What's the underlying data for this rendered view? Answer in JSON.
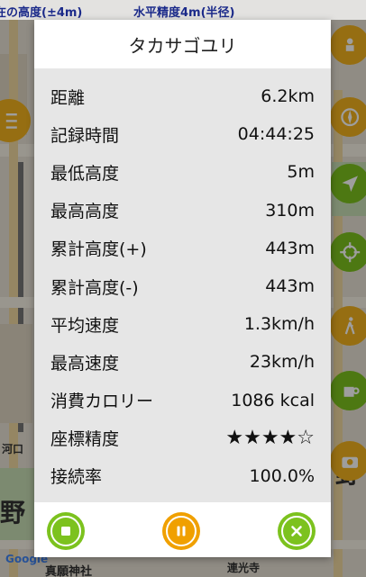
{
  "map": {
    "status_altitude": "在の高度(±4m)",
    "status_accuracy": "水平精度4m(半径)",
    "label_kawaguchi": "河口",
    "label_no": "野",
    "label_no2": "野",
    "label_temple": "真願神社",
    "label_temple2": "連光寺",
    "label_google": "Google"
  },
  "dialog": {
    "title": "タカサゴユリ",
    "rows": [
      {
        "label": "距離",
        "value": "6.2km"
      },
      {
        "label": "記録時間",
        "value": "04:44:25"
      },
      {
        "label": "最低高度",
        "value": "5m"
      },
      {
        "label": "最高高度",
        "value": "310m"
      },
      {
        "label": "累計高度(+)",
        "value": "443m"
      },
      {
        "label": "累計高度(-)",
        "value": "443m"
      },
      {
        "label": "平均速度",
        "value": "1.3km/h"
      },
      {
        "label": "最高速度",
        "value": "23km/h"
      },
      {
        "label": "消費カロリー",
        "value": "1086 kcal"
      },
      {
        "label": "座標精度",
        "value": "★★★★☆"
      },
      {
        "label": "接続率",
        "value": "100.0%"
      }
    ],
    "colors": {
      "stop": "#7cc21e",
      "pause": "#f0a000",
      "close": "#7cc21e"
    },
    "buttons": {
      "stop_icon": "stop-icon",
      "pause_icon": "pause-icon",
      "close_icon": "close-icon"
    }
  }
}
